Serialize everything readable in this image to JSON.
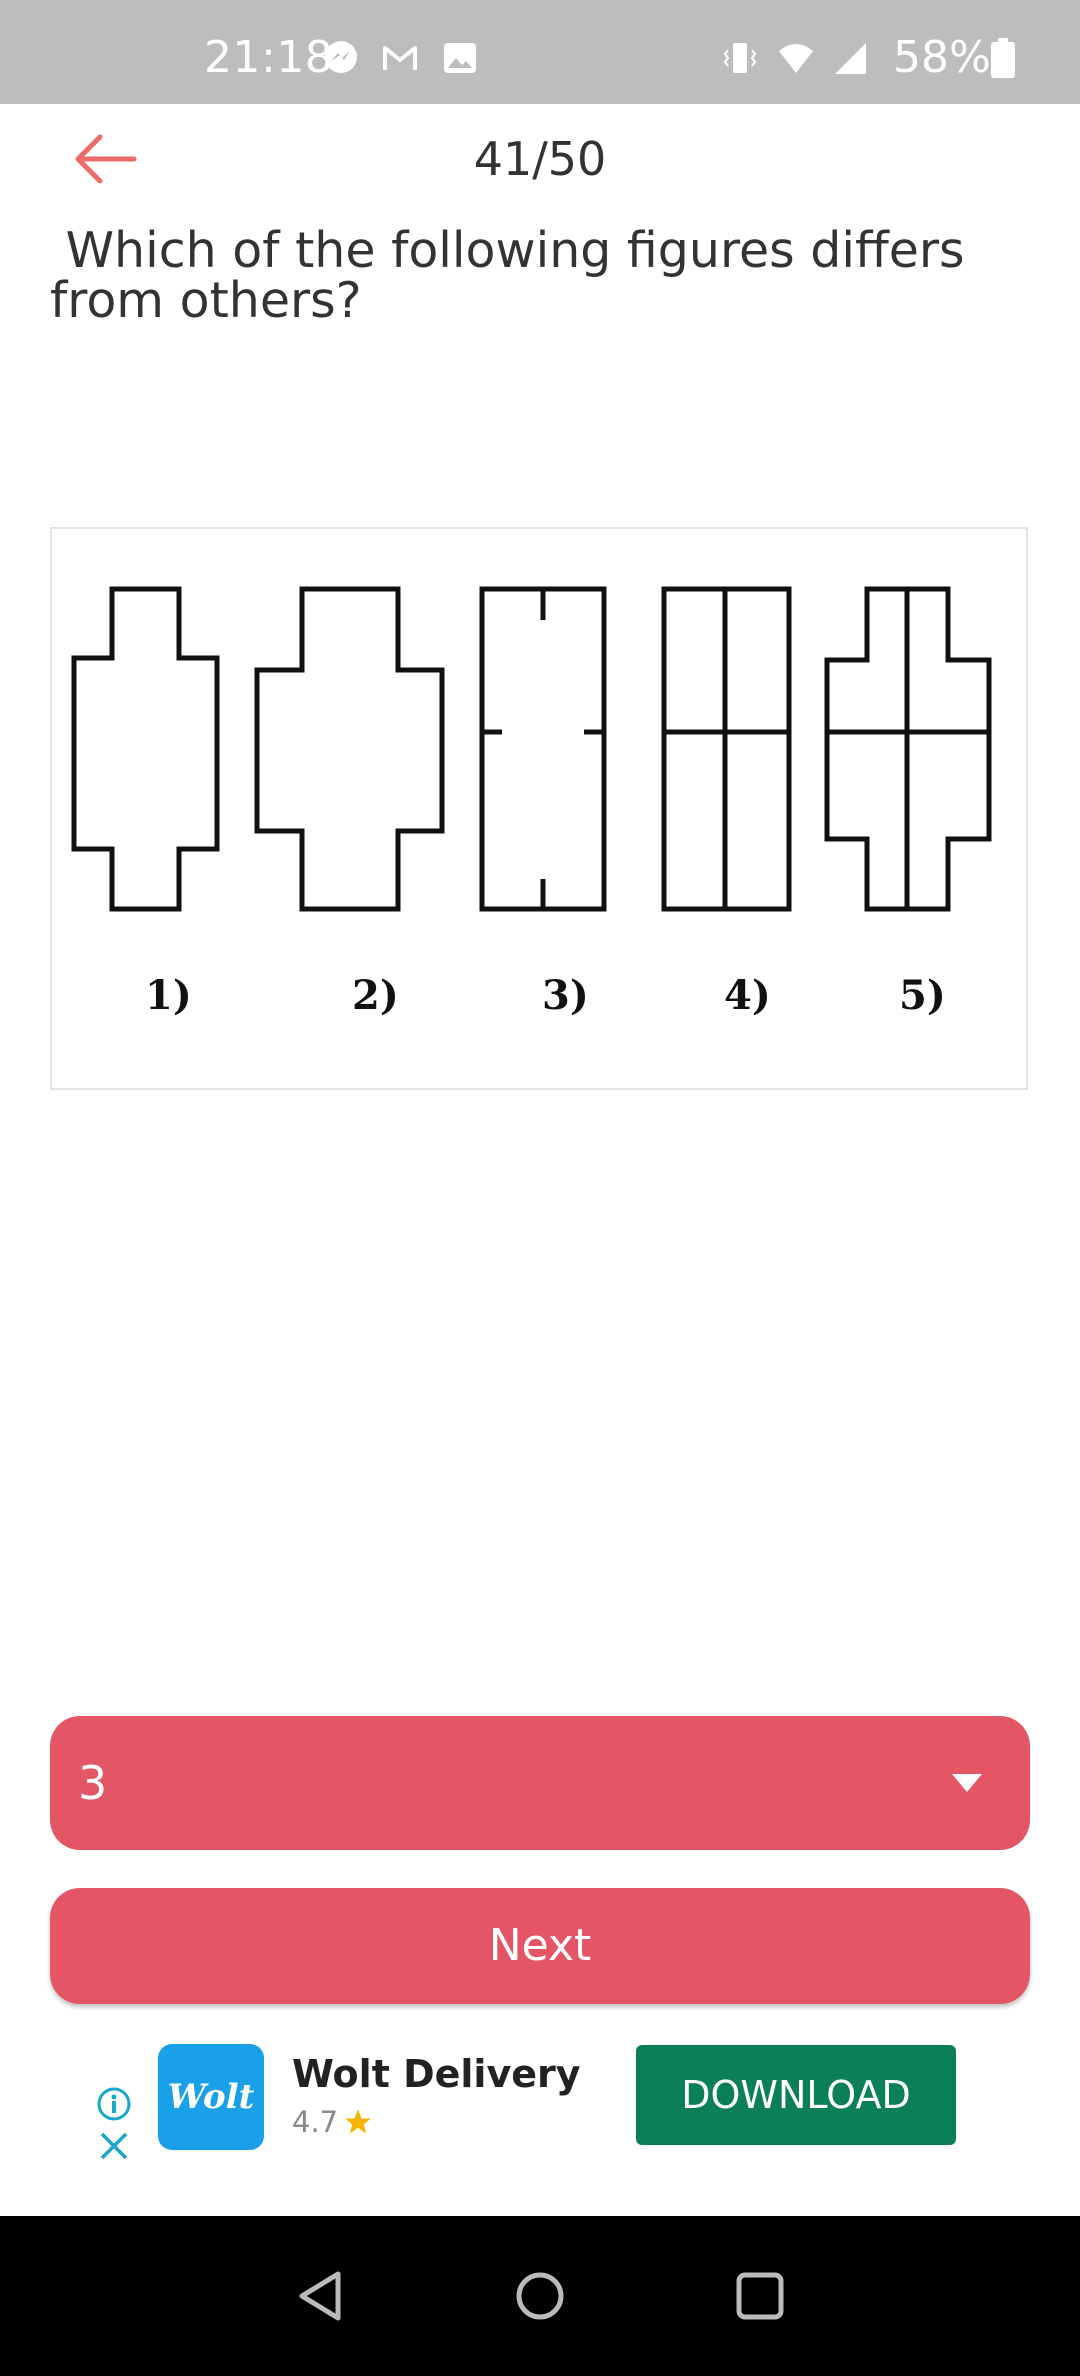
{
  "status_bar": {
    "time": "21:18",
    "battery": "58%",
    "left_icons": [
      "messenger-icon",
      "gmail-icon",
      "image-icon"
    ],
    "right_icons": [
      "vibrate-icon",
      "wifi-icon",
      "signal-icon",
      "battery-icon"
    ]
  },
  "header": {
    "back_icon": "arrow-left-icon",
    "progress": "41/50"
  },
  "question": {
    "text": " Which of the following figures differs\nfrom others?"
  },
  "figure": {
    "labels": [
      "1)",
      "2)",
      "3)",
      "4)",
      "5)"
    ]
  },
  "answer_select": {
    "value": "3"
  },
  "next_button": {
    "label": "Next"
  },
  "ad": {
    "logo_text": "Wolt",
    "app_name": "Wolt Delivery",
    "rating": "4.7",
    "cta": "DOWNLOAD"
  },
  "colors": {
    "accent": "#e45566",
    "back_arrow": "#ee6b6b",
    "status_bar": "#bdbdbd",
    "download_button": "#0a7f5a",
    "wolt_blue": "#1aa0e8"
  }
}
